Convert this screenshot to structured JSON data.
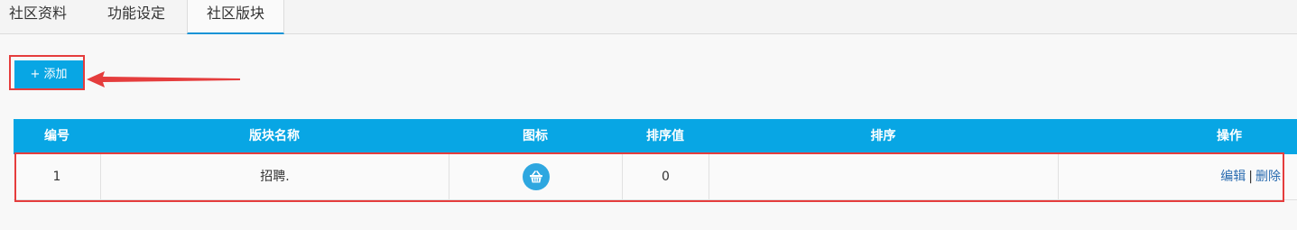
{
  "tabs": [
    {
      "label": "社区资料"
    },
    {
      "label": "功能设定"
    },
    {
      "label": "社区版块"
    }
  ],
  "toolbar": {
    "add_label": "+ 添加"
  },
  "table": {
    "headers": [
      "编号",
      "版块名称",
      "图标",
      "排序值",
      "排序",
      "操作"
    ],
    "rows": [
      {
        "id": "1",
        "name": "招聘.",
        "icon": "basket-icon",
        "sort_value": "0",
        "sort": "",
        "actions": {
          "edit": "编辑",
          "separator": "|",
          "delete": "删除"
        }
      }
    ]
  },
  "colors": {
    "accent": "#08a6e4",
    "highlight": "#e53d3d",
    "link": "#2b6cb0"
  }
}
